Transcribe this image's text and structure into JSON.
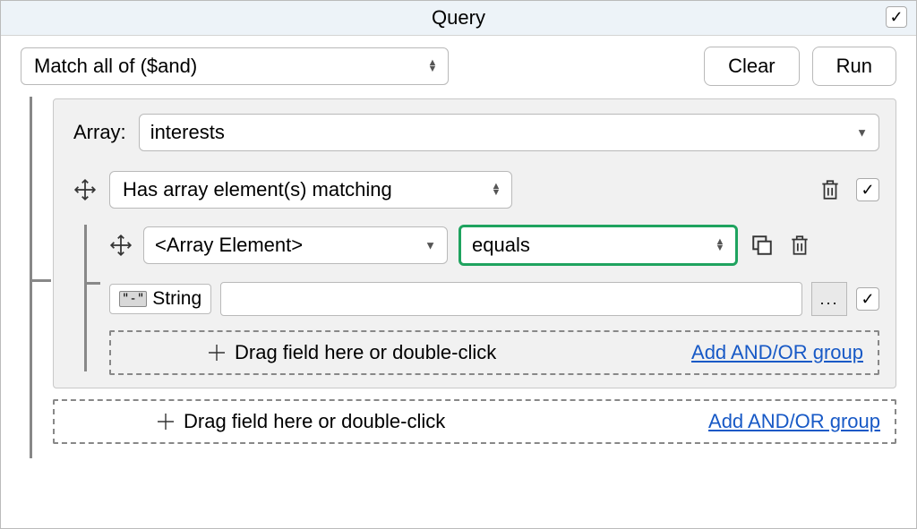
{
  "title": "Query",
  "match_mode": "Match all of ($and)",
  "buttons": {
    "clear": "Clear",
    "run": "Run"
  },
  "group": {
    "array_label": "Array:",
    "array_field": "interests",
    "operator": "Has array element(s) matching",
    "element": {
      "field_label": "<Array Element>",
      "comparator": "equals",
      "type_symbol": "\"-\"",
      "type_label": "String",
      "value": "",
      "ellipsis": "..."
    }
  },
  "drop": {
    "hint": "Drag field here or double-click",
    "link": "Add AND/OR group"
  },
  "check": "✓"
}
